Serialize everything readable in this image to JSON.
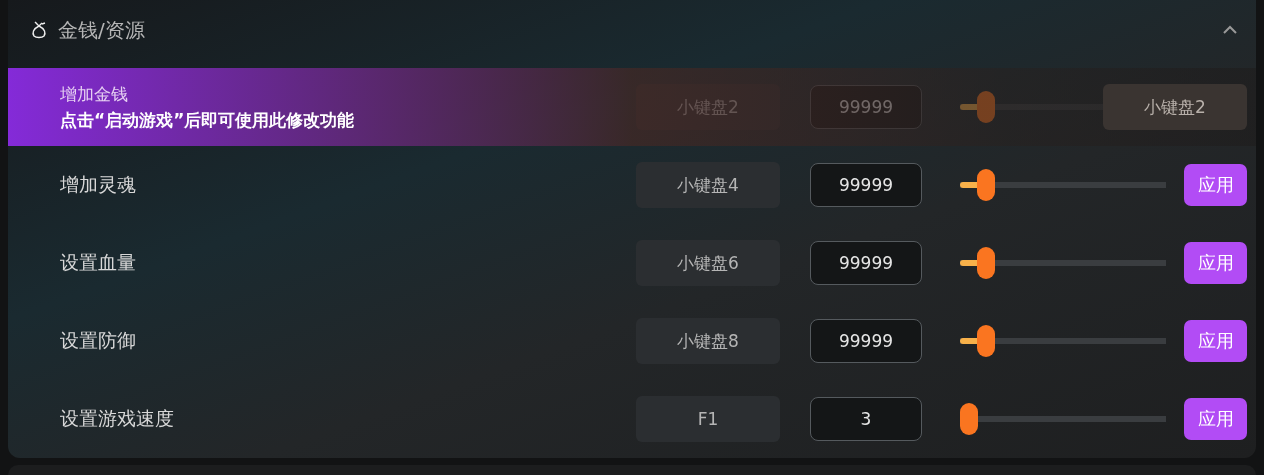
{
  "section": {
    "title": "金钱/资源",
    "expanded": true
  },
  "rows": [
    {
      "label": "增加金钱",
      "hotkey": "小键盘2",
      "value": "99999",
      "level": 0.09,
      "hovered": true,
      "hint": "点击“启动游戏”后即可使用此修改功能",
      "badge": "小键盘2"
    },
    {
      "label": "增加灵魂",
      "hotkey": "小键盘4",
      "value": "99999",
      "level": 0.09,
      "hovered": false,
      "button": "应用"
    },
    {
      "label": "设置血量",
      "hotkey": "小键盘6",
      "value": "99999",
      "level": 0.09,
      "hovered": false,
      "button": "应用"
    },
    {
      "label": "设置防御",
      "hotkey": "小键盘8",
      "value": "99999",
      "level": 0.09,
      "hovered": false,
      "button": "应用"
    },
    {
      "label": "设置游戏速度",
      "hotkey": "F1",
      "value": "3",
      "level": 0,
      "hovered": false,
      "button": "应用"
    }
  ]
}
